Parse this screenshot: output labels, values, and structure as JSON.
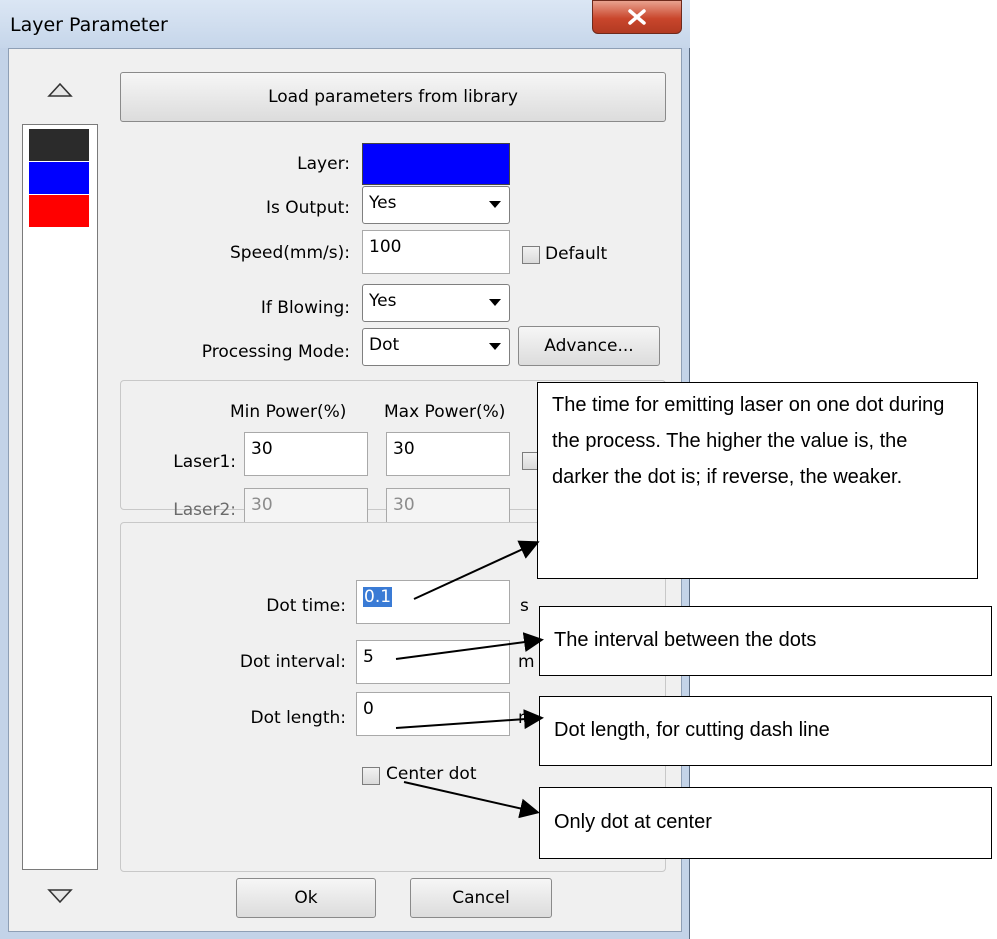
{
  "window": {
    "title": "Layer Parameter",
    "close_icon": "close-icon"
  },
  "layers": {
    "up_icon": "triangle-up-icon",
    "down_icon": "triangle-down-icon",
    "swatches": [
      "#2b2b2b",
      "#0000ff",
      "#ff0000"
    ]
  },
  "load_button": "Load parameters from library",
  "form": {
    "layer_label": "Layer:",
    "layer_color": "#0000ff",
    "is_output_label": "Is Output:",
    "is_output_value": "Yes",
    "speed_label": "Speed(mm/s):",
    "speed_value": "100",
    "default_label": "Default",
    "if_blowing_label": "If Blowing:",
    "if_blowing_value": "Yes",
    "mode_label": "Processing Mode:",
    "mode_value": "Dot",
    "advance_label": "Advance..."
  },
  "power": {
    "min_header": "Min Power(%)",
    "max_header": "Max Power(%)",
    "laser1_label": "Laser1:",
    "laser1_min": "30",
    "laser1_max": "30",
    "laser2_label": "Laser2:",
    "laser2_min": "30",
    "laser2_max": "30"
  },
  "dot": {
    "time_label": "Dot time:",
    "time_value": "0.1",
    "time_unit": "s",
    "interval_label": "Dot interval:",
    "interval_value": "5",
    "interval_unit": "m",
    "length_label": "Dot length:",
    "length_value": "0",
    "length_unit": "m",
    "center_label": "Center dot"
  },
  "footer": {
    "ok": "Ok",
    "cancel": "Cancel"
  },
  "callouts": {
    "dot_time": "The time for emitting laser on one dot during the process. The higher the value is, the darker the dot is; if reverse, the weaker.",
    "dot_interval": "The interval between the dots",
    "dot_length": "Dot length, for cutting dash line",
    "center_dot": "Only dot at center"
  }
}
